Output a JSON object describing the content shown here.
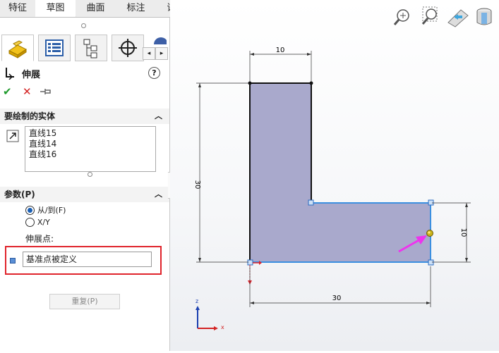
{
  "tabs": [
    {
      "label": "特征"
    },
    {
      "label": "草图"
    },
    {
      "label": "曲面"
    },
    {
      "label": "标注"
    },
    {
      "label": "评估"
    }
  ],
  "panel": {
    "title": "伸展",
    "help_glyph": "?",
    "actions": {
      "ok_glyph": "✔",
      "cancel_glyph": "✕"
    },
    "entities_section": {
      "header": "要绘制的实体",
      "items": [
        "直线15",
        "直线14",
        "直线16"
      ]
    },
    "params_section": {
      "header": "参数(P)",
      "radio_from_to": "从/到(F)",
      "radio_xy": "X/Y",
      "selected": "from_to",
      "extend_point_label": "伸展点:",
      "extend_point_value": "基准点被定义"
    },
    "repeat_button": "重复(P)"
  },
  "drawing": {
    "dims": {
      "top_width": "10",
      "left_height": "30",
      "right_height": "10",
      "bottom_width": "30"
    },
    "triad": {
      "z": "z",
      "x": "x"
    }
  },
  "colors": {
    "highlight_red": "#e0242c",
    "sketch_fill": "#a9a9cc",
    "select_blue": "#3b8fe0",
    "arrow_magenta": "#ee33ee"
  }
}
